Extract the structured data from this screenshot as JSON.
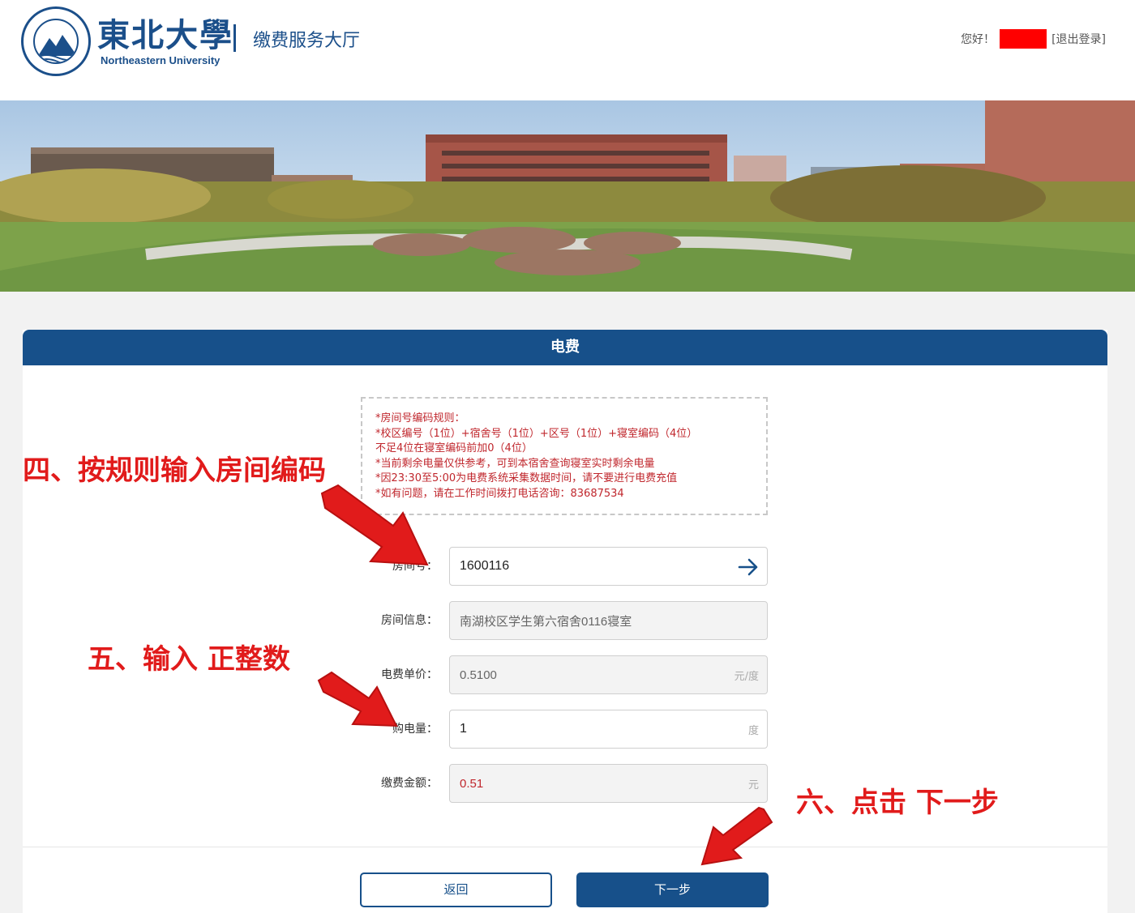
{
  "header": {
    "brand_cn": "東北大學",
    "brand_en": "Northeastern University",
    "hall_title": "缴费服务大厅",
    "greeting": "您好！",
    "logout": "[退出登录]"
  },
  "panel": {
    "title": "电费"
  },
  "notice": {
    "lines": [
      "*房间号编码规则：",
      "*校区编号（1位）+宿舍号（1位）+区号（1位）+寝室编码（4位）",
      "不足4位在寝室编码前加0（4位）",
      "*当前剩余电量仅供参考，可到本宿舍查询寝室实时剩余电量",
      "*因23:30至5:00为电费系统采集数据时间，请不要进行电费充值",
      "*如有问题，请在工作时间拨打电话咨询：83687534"
    ]
  },
  "form": {
    "room_no_label": "房间号：",
    "room_no_value": "1600116",
    "room_info_label": "房间信息：",
    "room_info_value": "南湖校区学生第六宿舍0116寝室",
    "unit_price_label": "电费单价：",
    "unit_price_value": "0.5100",
    "unit_price_unit": "元/度",
    "amount_label": "购电量：",
    "amount_value": "1",
    "amount_unit": "度",
    "payment_label": "缴费金额：",
    "payment_value": "0.51",
    "payment_unit": "元"
  },
  "buttons": {
    "back": "返回",
    "next": "下一步"
  },
  "annotations": {
    "step4": "四、按规则输入房间编码",
    "step5": "五、输入 正整数",
    "step6": "六、点击 下一步"
  },
  "colors": {
    "primary": "#17508a",
    "notice_red": "#c0272d",
    "annotation_red": "#e11b1b"
  }
}
